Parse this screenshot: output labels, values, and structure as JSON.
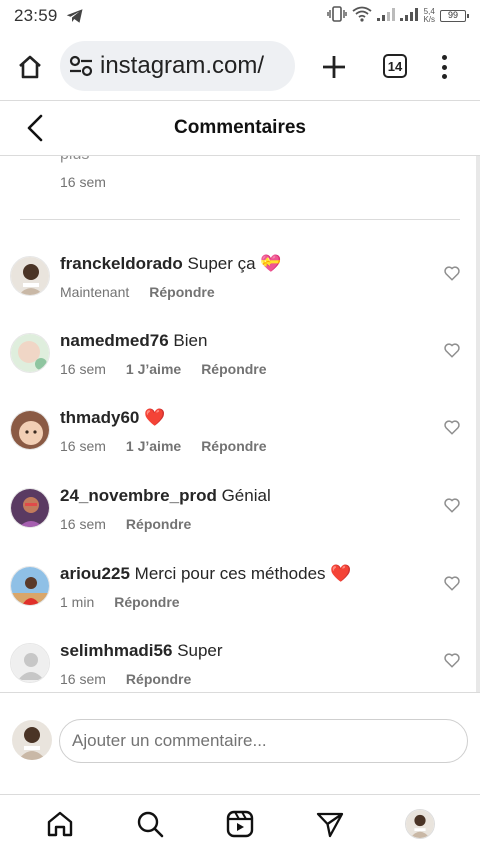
{
  "status_bar": {
    "time": "23:59",
    "net_speed_value": "5,4",
    "net_speed_unit": "K/s",
    "battery": "99"
  },
  "browser": {
    "url": "instagram.com/",
    "tab_count": "14"
  },
  "header": {
    "title": "Commentaires"
  },
  "previous_comment": {
    "truncated_text": "plus",
    "time": "16 sem"
  },
  "comments": [
    {
      "username": "franckeldorado",
      "text": "Super ça 💝",
      "time": "Maintenant",
      "likes": "",
      "reply": "Répondre",
      "avatar_color": "#c9b8a6"
    },
    {
      "username": "namedmed76",
      "text": "Bien",
      "time": "16 sem",
      "likes": "1 J’aime",
      "reply": "Répondre",
      "avatar_color": "#b7d6b0"
    },
    {
      "username": "thmady60",
      "text": "❤️",
      "time": "16 sem",
      "likes": "1 J’aime",
      "reply": "Répondre",
      "avatar_color": "#c79a7e"
    },
    {
      "username": "24_novembre_prod",
      "text": "Génial",
      "time": "16 sem",
      "likes": "",
      "reply": "Répondre",
      "avatar_color": "#7c4a7a"
    },
    {
      "username": "ariou225",
      "text": "Merci pour ces méthodes ❤️",
      "time": "1 min",
      "likes": "",
      "reply": "Répondre",
      "avatar_color": "#6f9cc2"
    },
    {
      "username": "selimhmadi56",
      "text": "Super",
      "time": "16 sem",
      "likes": "",
      "reply": "Répondre",
      "avatar_color": "#e3e3e3"
    }
  ],
  "add_comment": {
    "placeholder": "Ajouter un commentaire..."
  },
  "bottom_nav": {
    "items": [
      "home-icon",
      "search-icon",
      "reels-icon",
      "direct-message-icon",
      "profile-avatar"
    ]
  },
  "colors": {
    "text_primary": "#262626",
    "text_secondary": "#737373",
    "border": "#dbdbdb",
    "heart_red": "#ed1c2e"
  }
}
